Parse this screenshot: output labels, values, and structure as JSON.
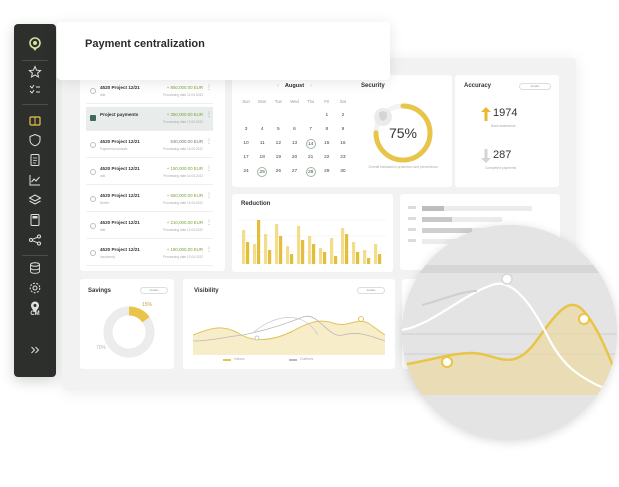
{
  "page_title": "Payment centralization",
  "sidebar": {
    "user_initials": "CM"
  },
  "payments": [
    {
      "name": "4520 Project 12/21",
      "sub": "ddd",
      "amount": "+ 850,000.00 EUR",
      "date": "Processing date 12.04.2022",
      "positive": true,
      "selected": false
    },
    {
      "name": "Project payments",
      "sub": "",
      "amount": "+ 350,000.00 EUR",
      "date": "Processing date 12.04.2022",
      "positive": true,
      "selected": true
    },
    {
      "name": "4520 Project 12/21",
      "sub": "Payment proposals",
      "amount": "530,000.00 EUR",
      "date": "Processing date 14.04.2022",
      "positive": false,
      "selected": false
    },
    {
      "name": "4520 Project 12/21",
      "sub": "ddd",
      "amount": "+ 150,000.00 EUR",
      "date": "Processing date 14.04.2022",
      "positive": true,
      "selected": false
    },
    {
      "name": "4520 Project 12/21",
      "sub": "Delete",
      "amount": "+ 650,000.00 EUR",
      "date": "Processing date 12.04.2022",
      "positive": true,
      "selected": false
    },
    {
      "name": "4520 Project 12/21",
      "sub": "ddd",
      "amount": "+ 210,000.00 EUR",
      "date": "Processing date 12.04.2022",
      "positive": true,
      "selected": false
    },
    {
      "name": "4520 Project 12/21",
      "sub": "Insolvency",
      "amount": "+ 180,000.00 EUR",
      "date": "Processing date 12.04.2022",
      "positive": true,
      "selected": false
    }
  ],
  "calendar": {
    "month": "August",
    "weekdays": [
      "Sun",
      "Mon",
      "Tue",
      "Wed",
      "Thu",
      "Fri",
      "Sat"
    ],
    "days": [
      "",
      "",
      "",
      "",
      "",
      "1",
      "2",
      "3",
      "4",
      "5",
      "6",
      "7",
      "8",
      "9",
      "10",
      "11",
      "12",
      "13",
      "14",
      "15",
      "16",
      "17",
      "18",
      "19",
      "20",
      "21",
      "22",
      "23",
      "24",
      "25",
      "26",
      "27",
      "28",
      "29",
      "30"
    ],
    "highlighted": [
      "14",
      "25",
      "28"
    ]
  },
  "security": {
    "title": "Security",
    "value": "75%",
    "level": 0.75,
    "label": "Overall transaction protection and preventions"
  },
  "accuracy": {
    "title": "Accuracy",
    "button": "details",
    "items": [
      {
        "value": "1974",
        "label": "Bank statements",
        "direction": "up",
        "color": "#e8b92e"
      },
      {
        "value": "287",
        "label": "Completed payments",
        "direction": "down",
        "color": "#cfcfcf"
      }
    ]
  },
  "reduction": {
    "title": "Reduction"
  },
  "savings": {
    "title": "Savings",
    "button": "details",
    "value_a": "15%",
    "value_b": "70%",
    "level": 0.15
  },
  "visibility": {
    "title": "Visibility",
    "button": "details",
    "legend": [
      "Inflows",
      "Outflows"
    ]
  },
  "colors": {
    "accent_yellow": "#e8c548",
    "dark_green": "#3d6b55",
    "sidebar_bg": "#2c2f2c"
  }
}
